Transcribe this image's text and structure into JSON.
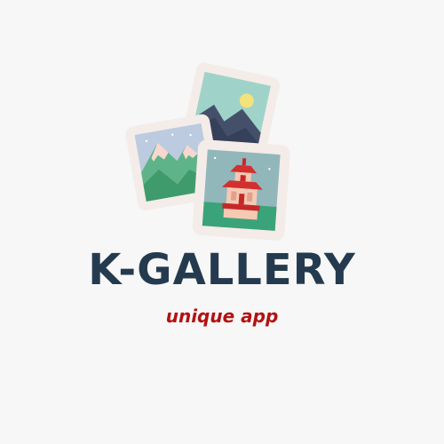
{
  "brand": {
    "name": "K-GALLERY",
    "tagline": "unique app"
  },
  "colors": {
    "background": "#f7f7f7",
    "name_text": "#243b4f",
    "tagline_text": "#b31212",
    "photo_frame": "#f4ece8"
  },
  "icons": [
    "mountain-sun-photo-icon",
    "snowy-mountain-photo-icon",
    "pagoda-photo-icon"
  ]
}
